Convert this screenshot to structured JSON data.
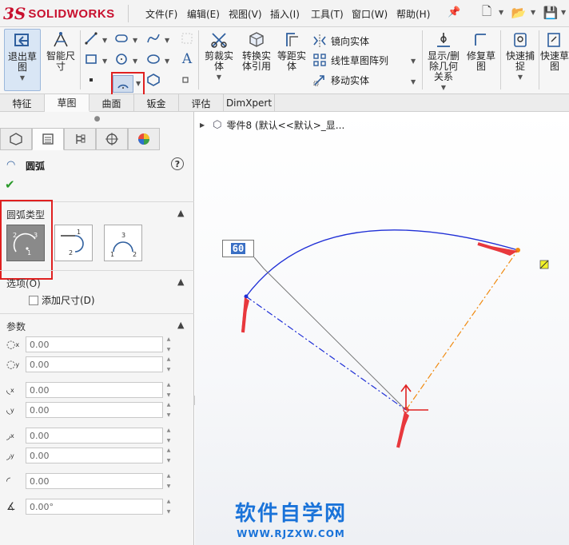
{
  "app": {
    "logo_ds": "3S",
    "logo_text": "SOLIDWORKS"
  },
  "menu": {
    "items": [
      "文件(F)",
      "编辑(E)",
      "视图(V)",
      "插入(I)",
      "工具(T)",
      "窗口(W)",
      "帮助(H)"
    ]
  },
  "ribbon": {
    "exit_sketch": "退出草图",
    "smart_dimension": "智能尺寸",
    "trim": "剪裁实体",
    "convert": "转换实体引用",
    "offset": "等距实体",
    "mirror": "镜向实体",
    "linear_pattern": "线性草图阵列",
    "move": "移动实体",
    "display_delete": "显示/删除几何关系",
    "repair": "修复草图",
    "quick_snaps": "快速捕捉",
    "quick_sketch": "快速草图"
  },
  "cm_tabs": [
    "特征",
    "草图",
    "曲面",
    "钣金",
    "评估",
    "DimXpert"
  ],
  "tree": {
    "part_label": "零件8 (默认<<默认>_显..."
  },
  "property_manager": {
    "title": "圆弧",
    "help": "?",
    "arc_type_group": "圆弧类型",
    "options_group": "选项(O)",
    "add_dimensions": "添加尺寸(D)",
    "params_group": "参数",
    "params": [
      "0.00",
      "0.00",
      "0.00",
      "0.00",
      "0.00",
      "0.00",
      "0.00",
      "0.00°"
    ]
  },
  "sketch": {
    "dimension_value": "60"
  },
  "watermark": {
    "main": "软件自学网",
    "url": "WWW.RJZXW.COM"
  }
}
